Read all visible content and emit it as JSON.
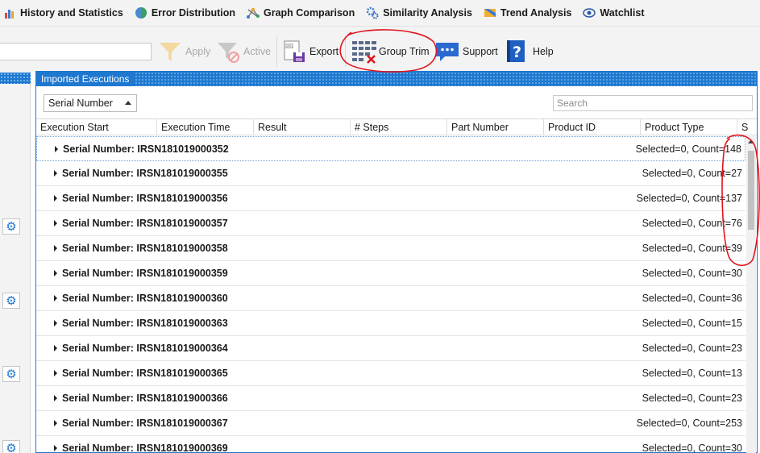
{
  "nav": {
    "items": [
      {
        "label": "History and Statistics",
        "icon": "bar-chart-icon"
      },
      {
        "label": "Error Distribution",
        "icon": "globe-icon"
      },
      {
        "label": "Graph Comparison",
        "icon": "network-icon"
      },
      {
        "label": "Similarity Analysis",
        "icon": "cogs-icon"
      },
      {
        "label": "Trend Analysis",
        "icon": "flag-icon"
      },
      {
        "label": "Watchlist",
        "icon": "eye-icon"
      }
    ]
  },
  "toolbar": {
    "apply_label": "Apply",
    "active_label": "Active",
    "export_label": "Export",
    "group_trim_label": "Group Trim",
    "support_label": "Support",
    "help_label": "Help"
  },
  "panel": {
    "title": "Imported Executions",
    "group_by": "Serial Number",
    "search_placeholder": "Search",
    "columns": [
      "Execution Start",
      "Execution Time",
      "Result",
      "# Steps",
      "Part Number",
      "Product ID",
      "Product Type",
      "S"
    ],
    "rows": [
      {
        "group": "Serial Number: IRSN181019000352",
        "count": "Selected=0,  Count=148"
      },
      {
        "group": "Serial Number: IRSN181019000355",
        "count": "Selected=0,  Count=27"
      },
      {
        "group": "Serial Number: IRSN181019000356",
        "count": "Selected=0,  Count=137"
      },
      {
        "group": "Serial Number: IRSN181019000357",
        "count": "Selected=0,  Count=76"
      },
      {
        "group": "Serial Number: IRSN181019000358",
        "count": "Selected=0,  Count=39"
      },
      {
        "group": "Serial Number: IRSN181019000359",
        "count": "Selected=0,  Count=30"
      },
      {
        "group": "Serial Number: IRSN181019000360",
        "count": "Selected=0,  Count=36"
      },
      {
        "group": "Serial Number: IRSN181019000363",
        "count": "Selected=0,  Count=15"
      },
      {
        "group": "Serial Number: IRSN181019000364",
        "count": "Selected=0,  Count=23"
      },
      {
        "group": "Serial Number: IRSN181019000365",
        "count": "Selected=0,  Count=13"
      },
      {
        "group": "Serial Number: IRSN181019000366",
        "count": "Selected=0,  Count=23"
      },
      {
        "group": "Serial Number: IRSN181019000367",
        "count": "Selected=0,  Count=253"
      },
      {
        "group": "Serial Number: IRSN181019000369",
        "count": "Selected=0,  Count=30"
      }
    ]
  },
  "colors": {
    "accent": "#1e78d0",
    "annotation": "#e0141e",
    "disabled_text": "#a8a8a8"
  }
}
